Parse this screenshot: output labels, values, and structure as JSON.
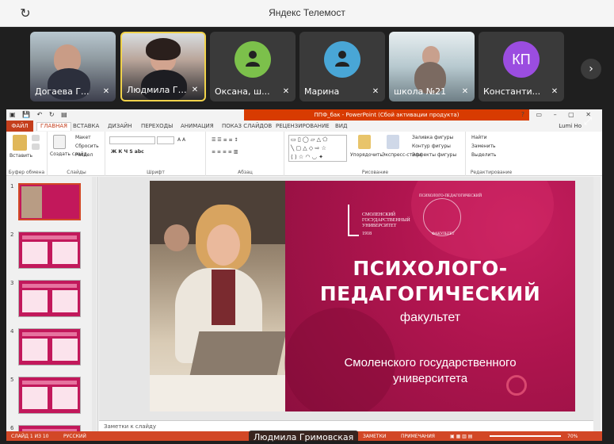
{
  "window": {
    "title": "Яндекс Телемост"
  },
  "participants": [
    {
      "name": "Догаева Г...",
      "mic_muted": true,
      "type": "photo"
    },
    {
      "name": "Людмила Гри...",
      "mic_muted": true,
      "type": "photo",
      "active": true
    },
    {
      "name": "Оксана, ш...",
      "mic_muted": true,
      "type": "avatar"
    },
    {
      "name": "Марина",
      "mic_muted": true,
      "type": "avatar"
    },
    {
      "name": "школа №21",
      "mic_muted": true,
      "type": "photo"
    },
    {
      "name": "Константи...",
      "initials": "КП",
      "mic_muted": true,
      "type": "avatar"
    }
  ],
  "ppt": {
    "doc_title": "ППФ_бак - PowerPoint (Сбой активации продукта)",
    "tabs": [
      "ФАЙЛ",
      "ГЛАВНАЯ",
      "ВСТАВКА",
      "ДИЗАЙН",
      "ПЕРЕХОДЫ",
      "АНИМАЦИЯ",
      "ПОКАЗ СЛАЙДОВ",
      "РЕЦЕНЗИРОВАНИЕ",
      "ВИД"
    ],
    "user": "Lumi Ho",
    "ribbon": {
      "paste": "Вставить",
      "clipboard": "Буфер обмена",
      "create_slide": "Создать слайд",
      "layout": "Макет",
      "reset": "Сбросить",
      "section": "Раздел",
      "slides": "Слайды",
      "font": "Шрифт",
      "paragraph": "Абзац",
      "arrange": "Упорядочить",
      "quick_styles": "Экспресс-стили",
      "fill": "Заливка фигуры",
      "outline": "Контур фигуры",
      "effects": "Эффекты фигуры",
      "drawing": "Рисование",
      "find": "Найти",
      "replace": "Заменить",
      "select": "Выделить",
      "editing": "Редактирование"
    },
    "thumb_numbers": [
      "1",
      "2",
      "3",
      "4",
      "5",
      "6"
    ],
    "slide": {
      "logo_left": "СМОЛЕНСКИЙ ГОСУДАРСТВЕННЫЙ УНИВЕРСИТЕТ",
      "logo_year": "1918",
      "logo_right_top": "ПСИХОЛОГО-ПЕДАГОГИЧЕСКИЙ",
      "logo_right_bottom": "ФАКУЛЬТЕТ",
      "heading_line1": "ПСИХОЛОГО-",
      "heading_line2": "ПЕДАГОГИЧЕСКИЙ",
      "sub": "факультет",
      "uni_line1": "Смоленского государственного",
      "uni_line2": "университета"
    },
    "notes_placeholder": "Заметки к слайду",
    "status": {
      "slide": "СЛАЙД 1 ИЗ 10",
      "lang": "РУССКИЙ",
      "notes": "ЗАМЕТКИ",
      "comments": "ПРИМЕЧАНИЯ",
      "zoom": "70%"
    }
  },
  "speaker_label": "Людмила Гримовская"
}
